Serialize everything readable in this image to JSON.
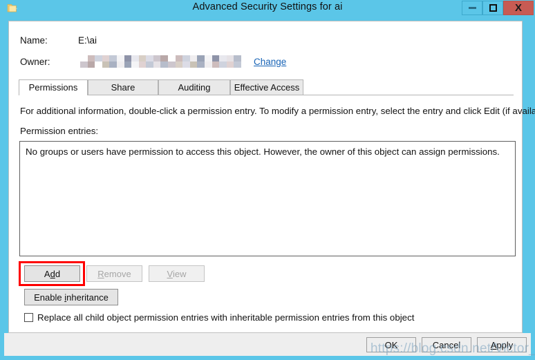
{
  "window": {
    "title": "Advanced Security Settings for ai",
    "icon": "folder-icon",
    "accent_color": "#5bc6e8",
    "close_color": "#c75b53",
    "controls": {
      "minimize": "–",
      "maximize": "□",
      "close": "X"
    }
  },
  "fields": {
    "name_label": "Name:",
    "name_value": "E:\\ai",
    "owner_label": "Owner:",
    "owner_value": "",
    "owner_redacted": true,
    "change_link": "Change"
  },
  "tabs": [
    {
      "label": "Permissions",
      "active": true
    },
    {
      "label": "Share",
      "active": false
    },
    {
      "label": "Auditing",
      "active": false
    },
    {
      "label": "Effective Access",
      "active": false
    }
  ],
  "main": {
    "info_text": "For additional information, double-click a permission entry. To modify a permission entry, select the entry and click Edit (if available).",
    "entries_label": "Permission entries:",
    "entries_empty_text": "No groups or users have permission to access this object. However, the owner of this object can assign permissions."
  },
  "buttons": {
    "add": {
      "label": "Add",
      "accel": "d",
      "enabled": true,
      "highlighted": true,
      "highlight_color": "#fe0000"
    },
    "remove": {
      "label": "Remove",
      "accel": "R",
      "enabled": false
    },
    "view": {
      "label": "View",
      "accel": "V",
      "enabled": false
    },
    "inheritance": {
      "label": "Enable inheritance",
      "accel": "i",
      "enabled": true
    }
  },
  "checkbox": {
    "label": "Replace all child object permission entries with inheritable permission entries from this object",
    "checked": false
  },
  "footer": {
    "ok": "OK",
    "cancel": "Cancel",
    "apply": "Apply"
  },
  "watermark": {
    "text": "https://blog.csdn.net/Victor_code"
  }
}
